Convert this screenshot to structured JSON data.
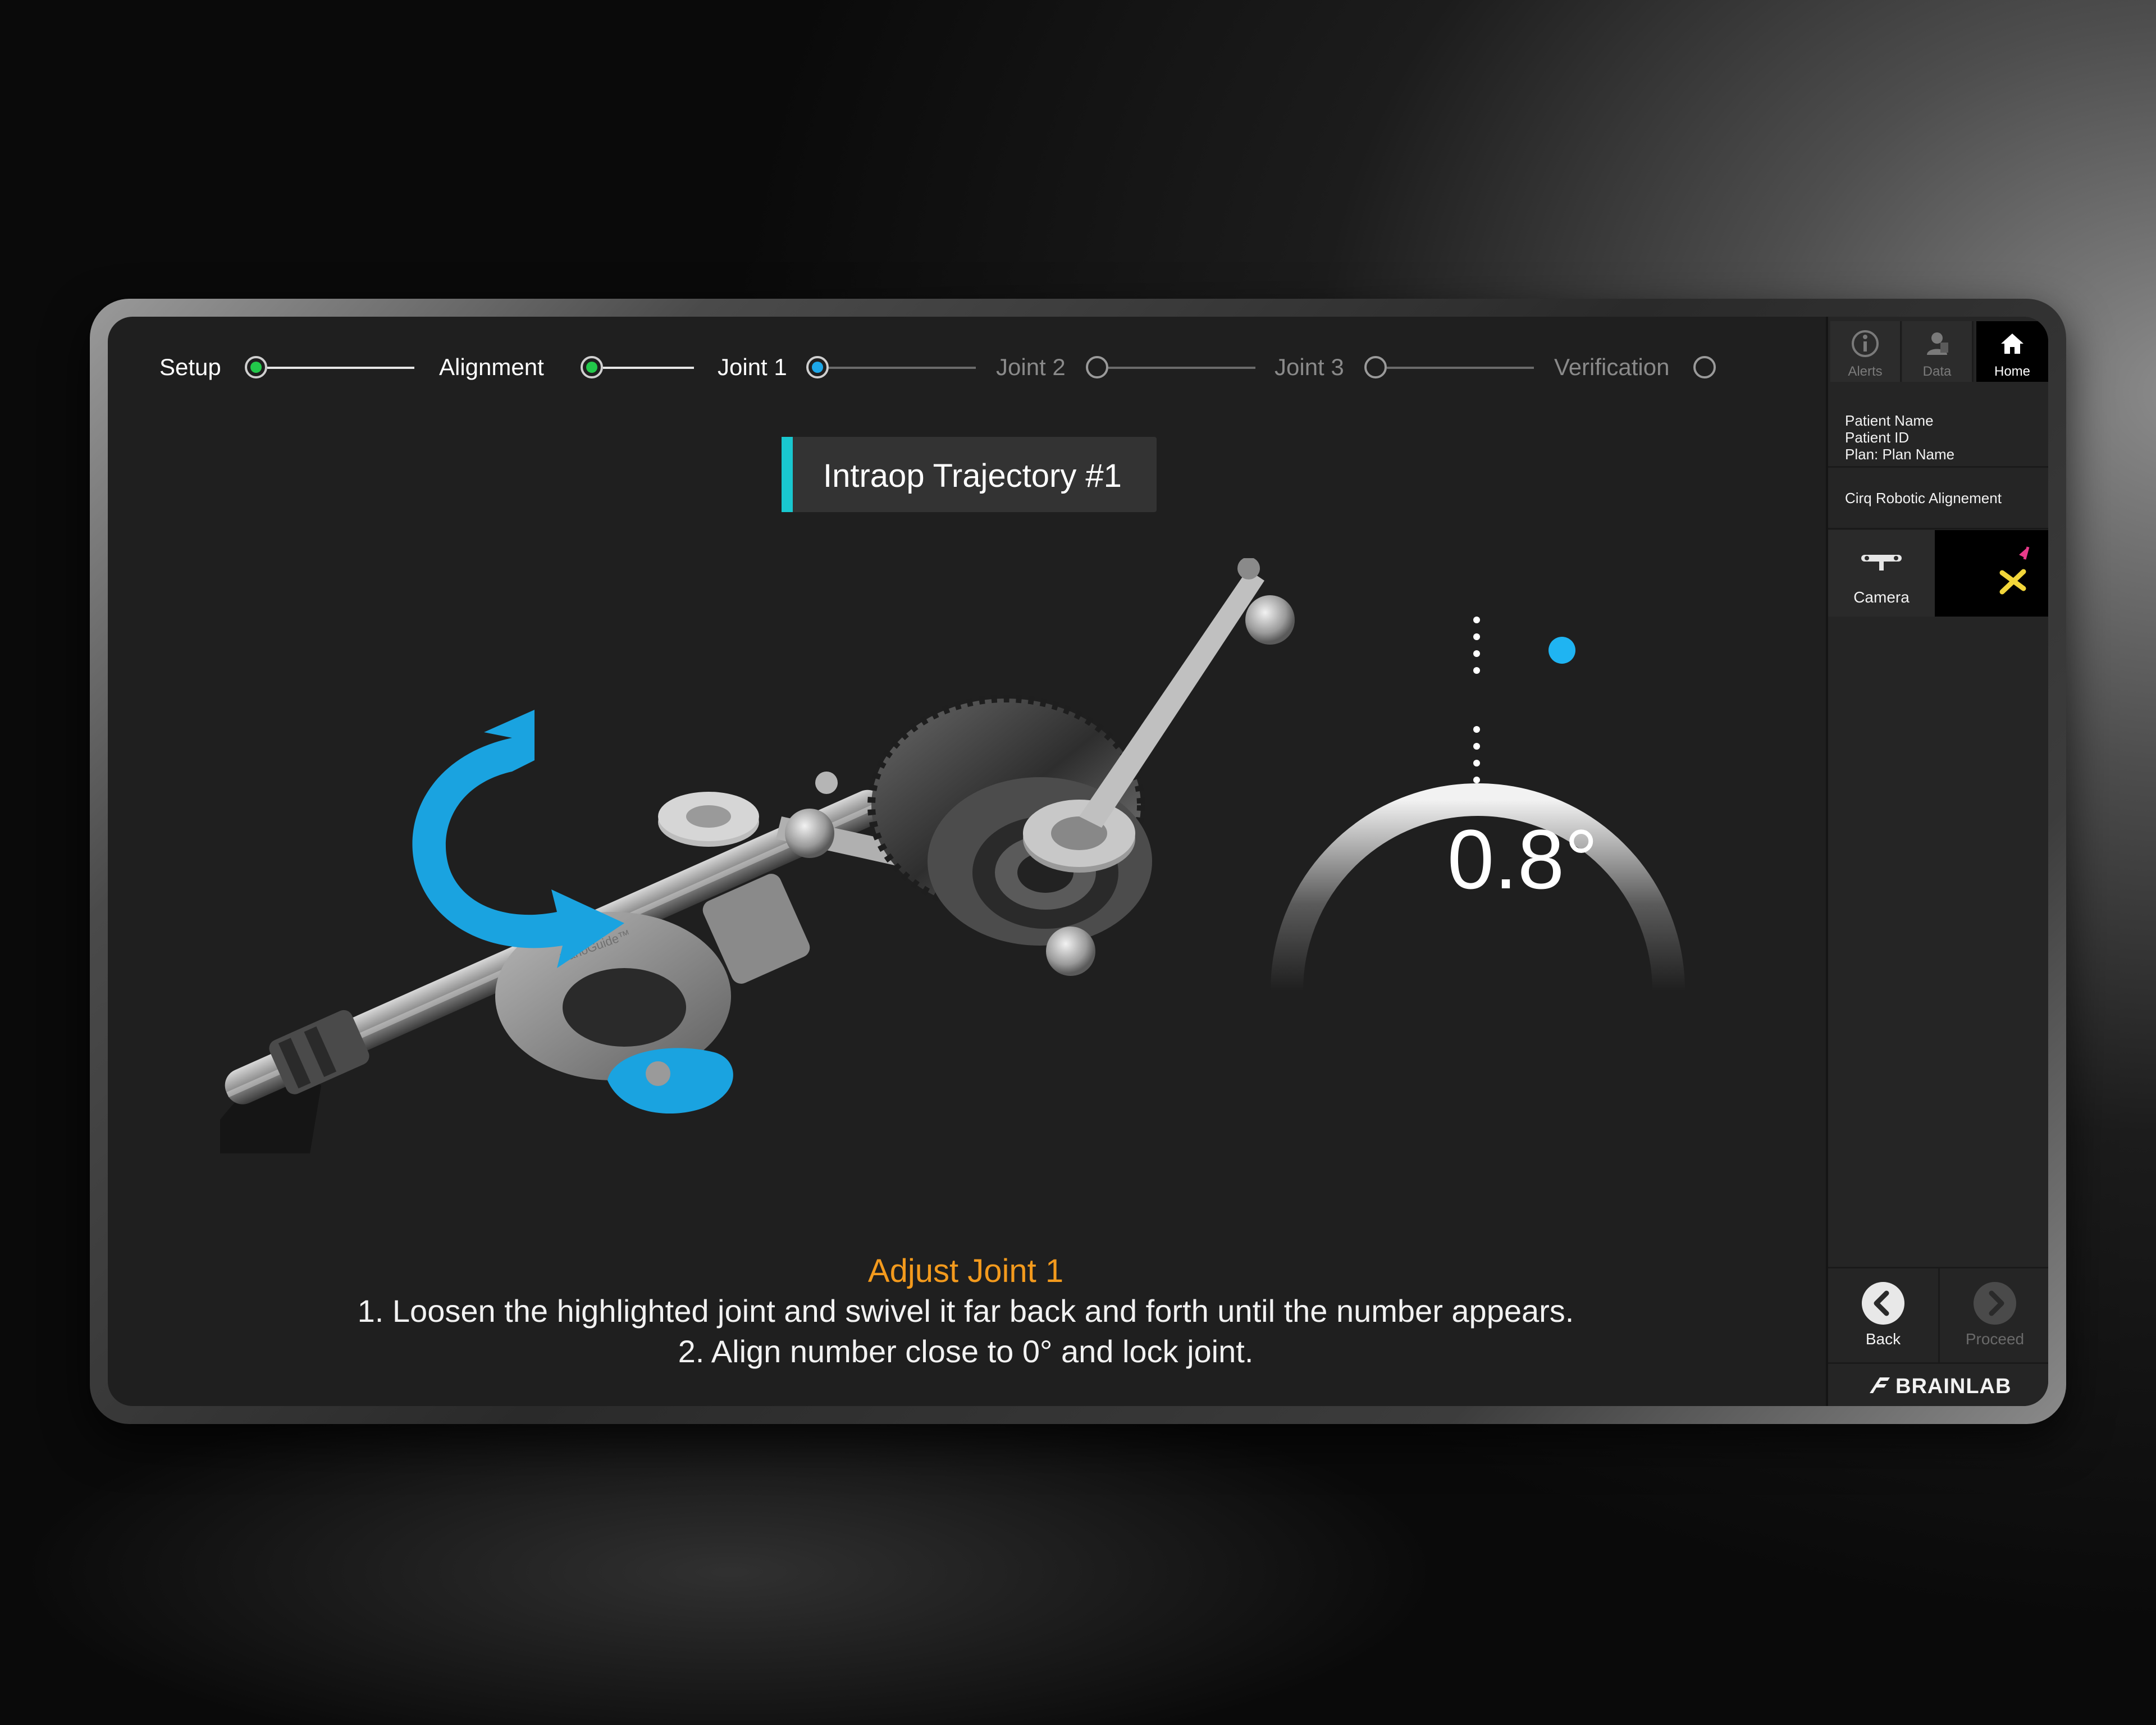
{
  "stepper": {
    "steps": [
      {
        "label": "Setup",
        "state": "done"
      },
      {
        "label": "Alignment",
        "state": "done"
      },
      {
        "label": "Joint 1",
        "state": "active"
      },
      {
        "label": "Joint 2",
        "state": "todo"
      },
      {
        "label": "Joint 3",
        "state": "todo"
      },
      {
        "label": "Verification",
        "state": "todo"
      }
    ],
    "colors": {
      "done": "#22c84a",
      "active": "#1da7e8",
      "todo_text": "#8a8a8a"
    }
  },
  "main": {
    "trajectory_title": "Intraop Trajectory #1",
    "illustration_engraving": "VarioGuide™",
    "gauge": {
      "value": "0.8°",
      "indicator_color": "#1fb4f2"
    },
    "instructions": {
      "title": "Adjust Joint 1",
      "line1": "1. Loosen the highlighted joint and swivel it far back and forth until the number appears.",
      "line2": "2. Align number close to 0° and lock joint."
    }
  },
  "sidebar": {
    "tabs": [
      {
        "label": "Alerts",
        "icon": "info-icon"
      },
      {
        "label": "Data",
        "icon": "data-icon"
      },
      {
        "label": "Home",
        "icon": "home-icon",
        "active": true
      }
    ],
    "patient": {
      "name": "Patient Name",
      "id": "Patient ID",
      "plan": "Plan: Plan Name"
    },
    "workflow": "Cirq Robotic Alignement",
    "camera_label": "Camera",
    "nav": {
      "back": "Back",
      "proceed": "Proceed"
    },
    "brand": "BRAINLAB"
  },
  "colors": {
    "accent": "#19c7cf",
    "instruction_title": "#f39a1d",
    "blue_highlight": "#1aa3e0"
  }
}
